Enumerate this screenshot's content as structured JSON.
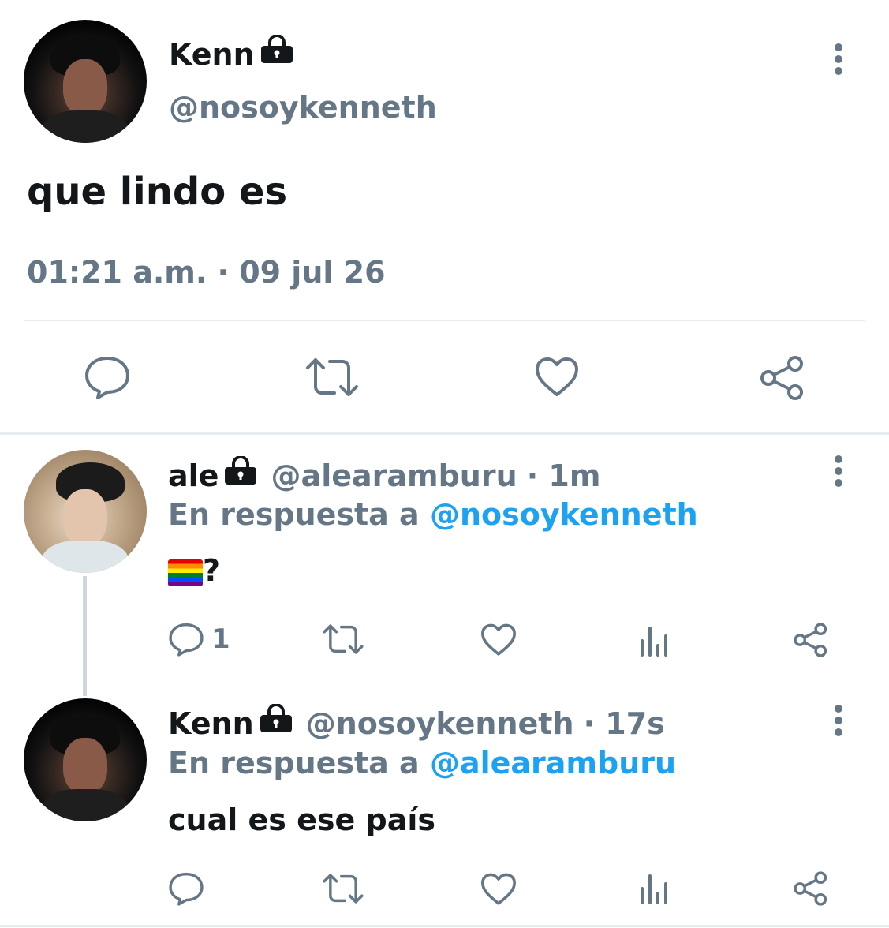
{
  "main_tweet": {
    "display_name": "Kenn",
    "handle": "@nosoykenneth",
    "text": "que lindo es",
    "timestamp": "01:21 a.m. · 09 jul 26",
    "actions": [
      "reply-icon",
      "retweet-icon",
      "like-icon",
      "share-icon"
    ]
  },
  "replies": [
    {
      "display_name": "ale",
      "handle": "@alearamburu",
      "time": "· 1m",
      "reply_prefix": "En respuesta a",
      "reply_to": "@nosoykenneth",
      "text_suffix": "?",
      "reply_count": "1"
    },
    {
      "display_name": "Kenn",
      "handle": "@nosoykenneth",
      "time": "· 17s",
      "reply_prefix": "En respuesta a",
      "reply_to": "@alearamburu",
      "text": "cual es ese país"
    }
  ],
  "colors": {
    "text": "#14171a",
    "secondary": "#657786",
    "link": "#1da1f2",
    "divider": "#e6ecf0"
  }
}
